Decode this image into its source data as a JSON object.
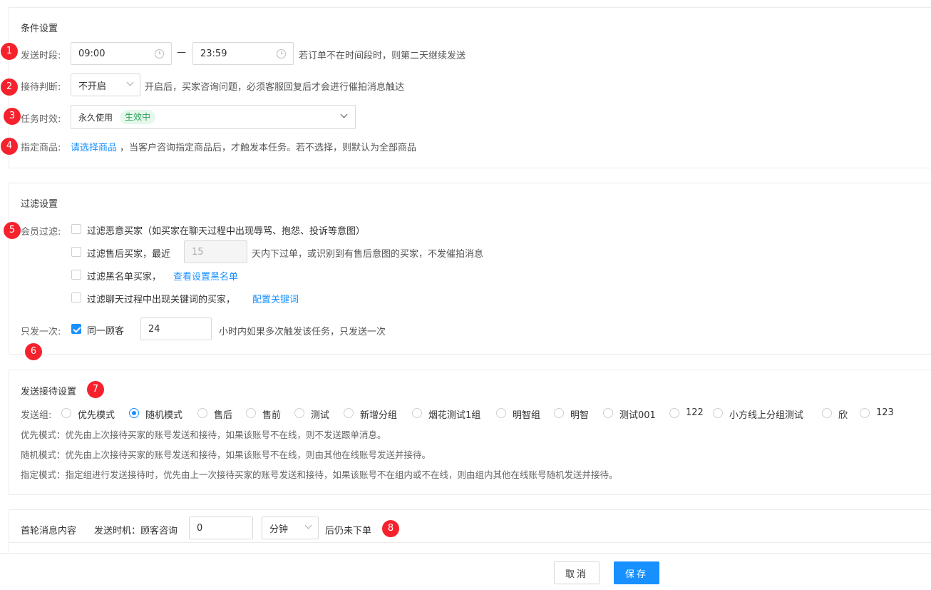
{
  "condition": {
    "title": "条件设置",
    "send_time": {
      "label": "发送时段:",
      "start": "09:00",
      "separator": "—",
      "end": "23:59",
      "hint": "若订单不在时间段时，则第二天继续发送"
    },
    "reception": {
      "label": "接待判断:",
      "value": "不开启",
      "hint": "开启后，买家咨询问题，必须客服回复后才会进行催拍消息触达"
    },
    "validity": {
      "label": "任务时效:",
      "value": "永久使用",
      "tag": "生效中"
    },
    "product": {
      "label": "指定商品:",
      "link": "请选择商品",
      "hint": "，当客户咨询指定商品后，才触发本任务。若不选择，则默认为全部商品"
    }
  },
  "filter": {
    "title": "过滤设置",
    "member_label": "会员过滤:",
    "options": [
      {
        "text": "过滤恶意买家（如买家在聊天过程中出现辱骂、抱怨、投诉等意图）",
        "checked": false
      },
      {
        "text": "过滤售后买家，最近",
        "checked": false,
        "days": "15",
        "suffix": "天内下过单，或识别到有售后意图的买家，不发催拍消息"
      },
      {
        "text": "过滤黑名单买家，",
        "checked": false,
        "link": "查看设置黑名单"
      },
      {
        "text": "过滤聊天过程中出现关键词的买家，",
        "checked": false,
        "link": "配置关键词"
      }
    ],
    "once": {
      "label": "只发一次:",
      "checkbox_text": "同一顾客",
      "checked": true,
      "hours": "24",
      "hint": "小时内如果多次触发该任务，只发送一次"
    }
  },
  "reception_setting": {
    "title": "发送接待设置",
    "group_label": "发送组:",
    "groups": [
      {
        "name": "优先模式",
        "checked": false
      },
      {
        "name": "随机模式",
        "checked": true
      },
      {
        "name": "售后",
        "checked": false
      },
      {
        "name": "售前",
        "checked": false
      },
      {
        "name": "测试",
        "checked": false
      },
      {
        "name": "新增分组",
        "checked": false
      },
      {
        "name": "烟花测试1组",
        "checked": false
      },
      {
        "name": "明智组",
        "checked": false
      },
      {
        "name": "明智",
        "checked": false
      },
      {
        "name": "测试001",
        "checked": false
      },
      {
        "name": "122",
        "checked": false
      },
      {
        "name": "小方线上分组测试",
        "checked": false
      },
      {
        "name": "欣",
        "checked": false
      },
      {
        "name": "123",
        "checked": false
      }
    ],
    "desc": [
      "优先模式：优先由上次接待买家的账号发送和接待，如果该账号不在线，则不发送跟单消息。",
      "随机模式：优先由上次接待买家的账号发送和接待，如果该账号不在线，则由其他在线账号发送并接待。",
      "指定模式：指定组进行发送接待时，优先由上一次接待买家的账号发送和接待，如果该账号不在组内或不在线，则由组内其他在线账号随机发送并接待。"
    ]
  },
  "first_round": {
    "title": "首轮消息内容",
    "timing_label": "发送时机：顾客咨询",
    "value": "0",
    "unit": "分钟",
    "suffix": "后仍未下单"
  },
  "markers": [
    "1",
    "2",
    "3",
    "4",
    "5",
    "6",
    "7",
    "8"
  ],
  "buttons": {
    "cancel": "取消",
    "save": "保存"
  }
}
